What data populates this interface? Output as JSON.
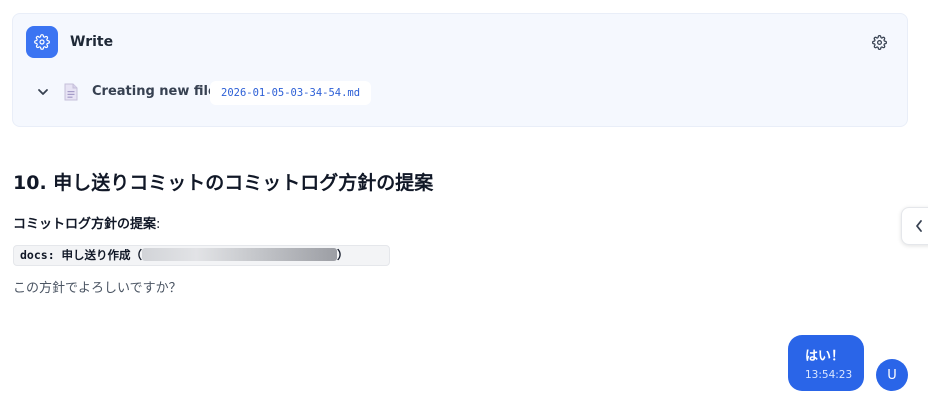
{
  "tool_card": {
    "icon": "gear-icon",
    "title": "Write",
    "settings_icon": "gear-icon",
    "toggle_icon": "chevron-down-icon",
    "file_icon": "document-icon",
    "file_label": "Creating new file:",
    "file_name": "2026-01-05-03-34-54.md",
    "accent_color": "#3b74f2"
  },
  "message": {
    "heading": "10. 申し送りコミットのコミットログ方針の提案",
    "subheading": "コミットログ方針の提案",
    "subheading_suffix": ":",
    "code_prefix": "docs: 申し送り作成（",
    "code_suffix": "）",
    "question": "この方針でよろしいですか？"
  },
  "side_panel": {
    "toggle_icon": "chevron-left-icon"
  },
  "user_message": {
    "text": "はい！",
    "time": "13:54:23",
    "avatar_initial": "U",
    "bubble_color": "#2a65e8"
  }
}
